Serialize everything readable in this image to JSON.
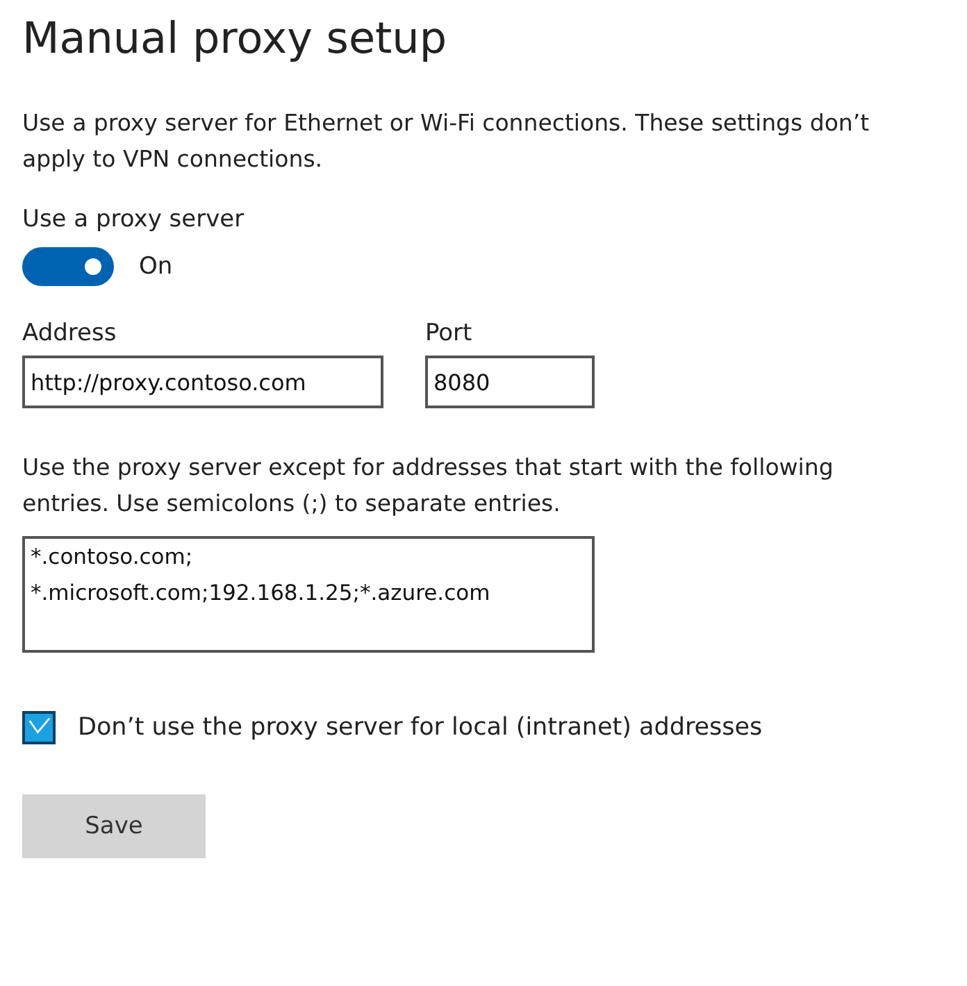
{
  "title": "Manual proxy setup",
  "description": "Use a proxy server for Ethernet or Wi-Fi connections. These settings don’t apply to VPN connections.",
  "proxy_toggle": {
    "label": "Use a proxy server",
    "on": true,
    "state_text": "On"
  },
  "address": {
    "label": "Address",
    "value": "http://proxy.contoso.com"
  },
  "port": {
    "label": "Port",
    "value": "8080"
  },
  "exceptions": {
    "label": "Use the proxy server except for addresses that start with the following entries. Use semicolons (;) to separate entries.",
    "value": "*.contoso.com;\n*.microsoft.com;192.168.1.25;*.azure.com"
  },
  "local_bypass": {
    "label": "Don’t use the proxy server for local (intranet) addresses",
    "checked": true
  },
  "buttons": [
    "Save"
  ]
}
